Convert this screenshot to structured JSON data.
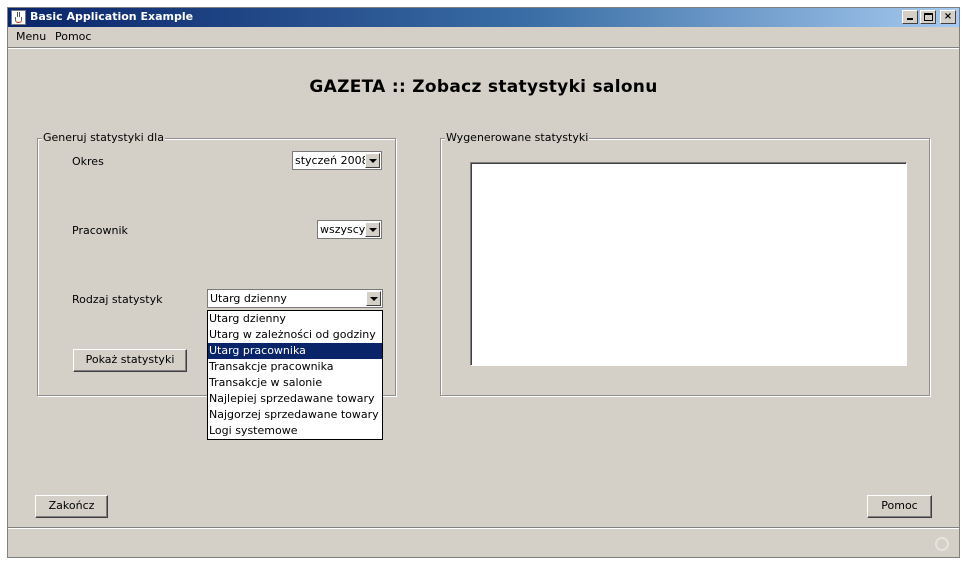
{
  "window": {
    "title": "Basic Application Example",
    "controls": {
      "minimize": "minimize",
      "maximize": "maximize",
      "close": "×"
    }
  },
  "menubar": {
    "items": [
      "Menu",
      "Pomoc"
    ]
  },
  "heading": "GAZETA :: Zobacz statystyki salonu",
  "left_panel": {
    "title": "Generuj statystyki dla",
    "okres_label": "Okres",
    "okres_value": "styczeń 2008",
    "pracownik_label": "Pracownik",
    "pracownik_value": "wszyscy",
    "rodzaj_label": "Rodzaj statystyk",
    "rodzaj_value": "Utarg dzienny",
    "show_button": "Pokaż statystyki"
  },
  "dropdown": {
    "options": [
      "Utarg dzienny",
      "Utarg w zależności od godziny",
      "Utarg pracownika",
      "Transakcje pracownika",
      "Transakcje w salonie",
      "Najlepiej sprzedawane towary",
      "Najgorzej sprzedawane towary",
      "Logi systemowe"
    ],
    "highlighted_index": 2
  },
  "right_panel": {
    "title": "Wygenerowane statystyki",
    "content": ""
  },
  "footer": {
    "exit_button": "Zakończ",
    "help_button": "Pomoc"
  },
  "colors": {
    "face": "#d4d0c8",
    "selection": "#0a246a",
    "title_gradient_start": "#0a246a",
    "title_gradient_end": "#a6caf0"
  }
}
